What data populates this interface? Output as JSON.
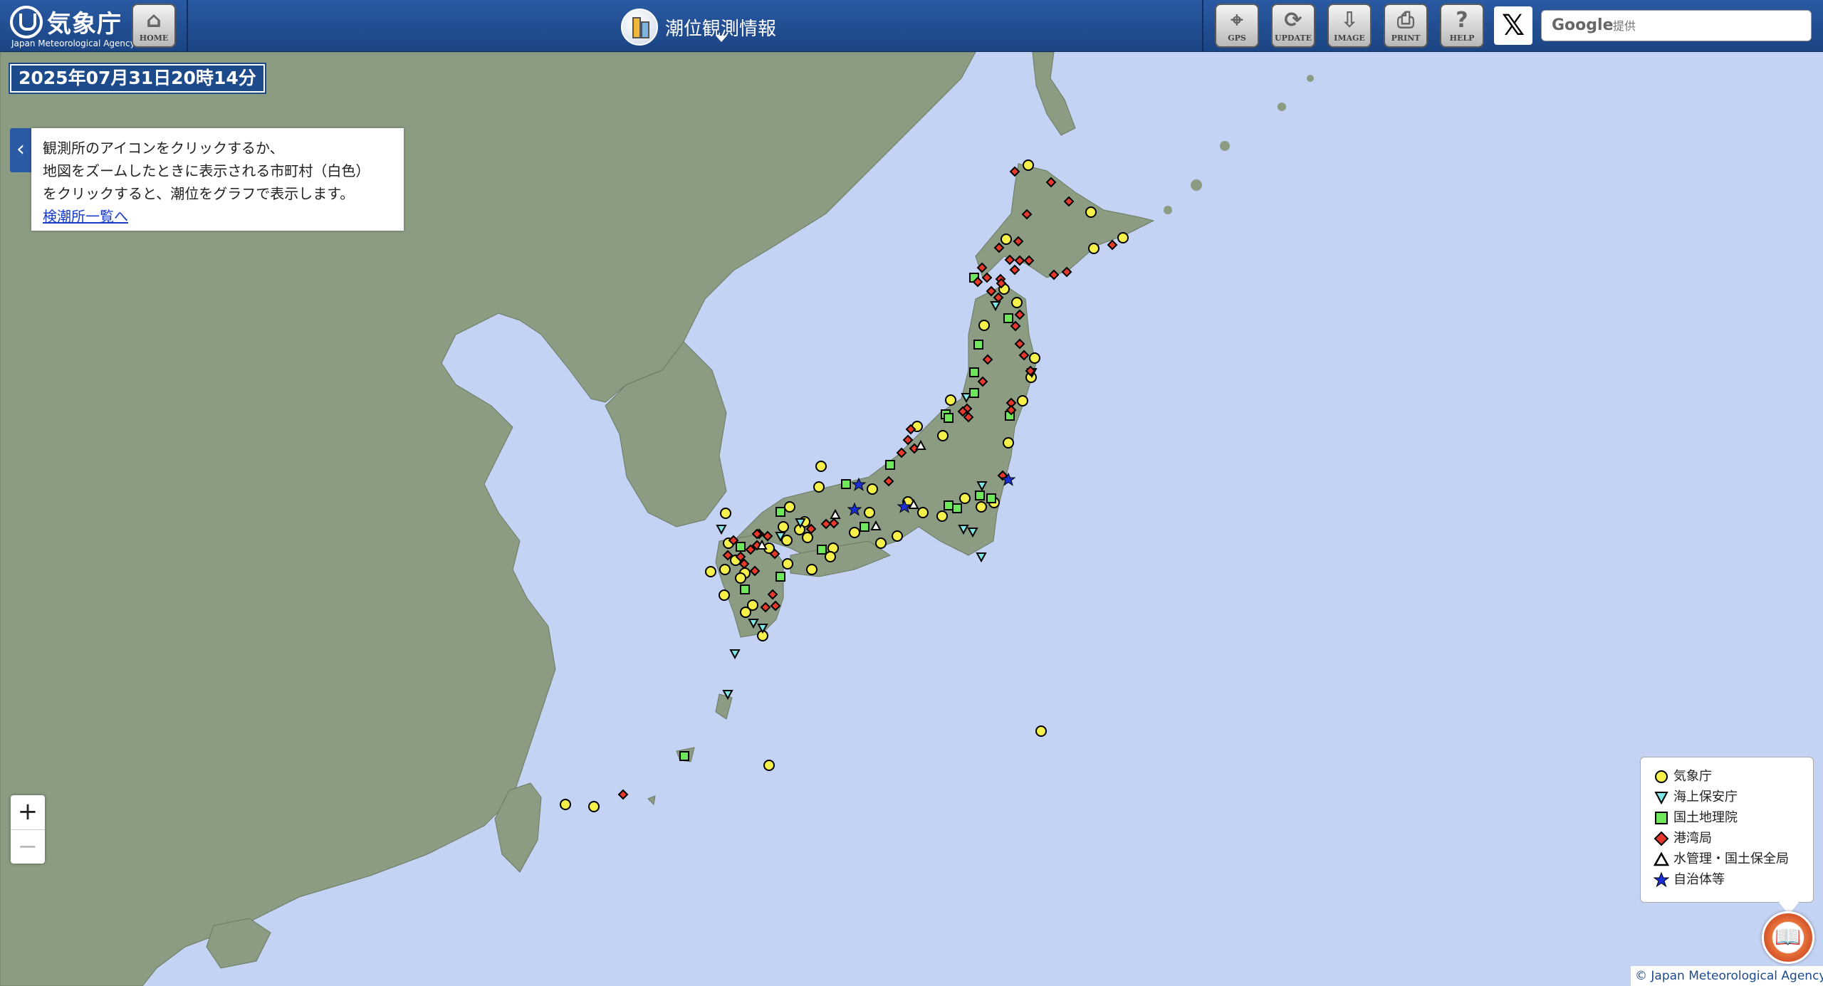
{
  "header": {
    "logo_text": "気象庁",
    "logo_sub": "Japan Meteorological Agency",
    "home_label": "HOME",
    "title": "潮位観測情報",
    "buttons": [
      {
        "label": "GPS",
        "icon": "gps-icon"
      },
      {
        "label": "UPDATE",
        "icon": "refresh-icon"
      },
      {
        "label": "IMAGE",
        "icon": "download-icon"
      },
      {
        "label": "PRINT",
        "icon": "print-icon"
      },
      {
        "label": "HELP",
        "icon": "help-icon"
      }
    ],
    "x_label": "𝕏",
    "search": {
      "brand": "Google",
      "placeholder": "提供"
    }
  },
  "datetime": "2025年07月31日20時14分",
  "info": {
    "line1": "観測所のアイコンをクリックするか、",
    "line2": "地図をズームしたときに表示される市町村（白色）",
    "line3": "をクリックすると、潮位をグラフで表示します。",
    "link": "検潮所一覧へ"
  },
  "zoom": {
    "in": "+",
    "out": "−"
  },
  "legend": [
    {
      "label": "気象庁",
      "shape": "circle",
      "color": "#f5f04a"
    },
    {
      "label": "海上保安庁",
      "shape": "triangle-down",
      "color": "#7fe6e6"
    },
    {
      "label": "国土地理院",
      "shape": "square",
      "color": "#6ee85a"
    },
    {
      "label": "港湾局",
      "shape": "diamond",
      "color": "#e8382a"
    },
    {
      "label": "水管理・国土保全局",
      "shape": "triangle-up",
      "color": "#ffffff"
    },
    {
      "label": "自治体等",
      "shape": "star",
      "color": "#1a2fd6"
    }
  ],
  "copyright": "© Japan Meteorological Agency",
  "colors": {
    "sea": "#c4d3f4",
    "land": "#8b9c82",
    "header": "#2a5aa3"
  }
}
